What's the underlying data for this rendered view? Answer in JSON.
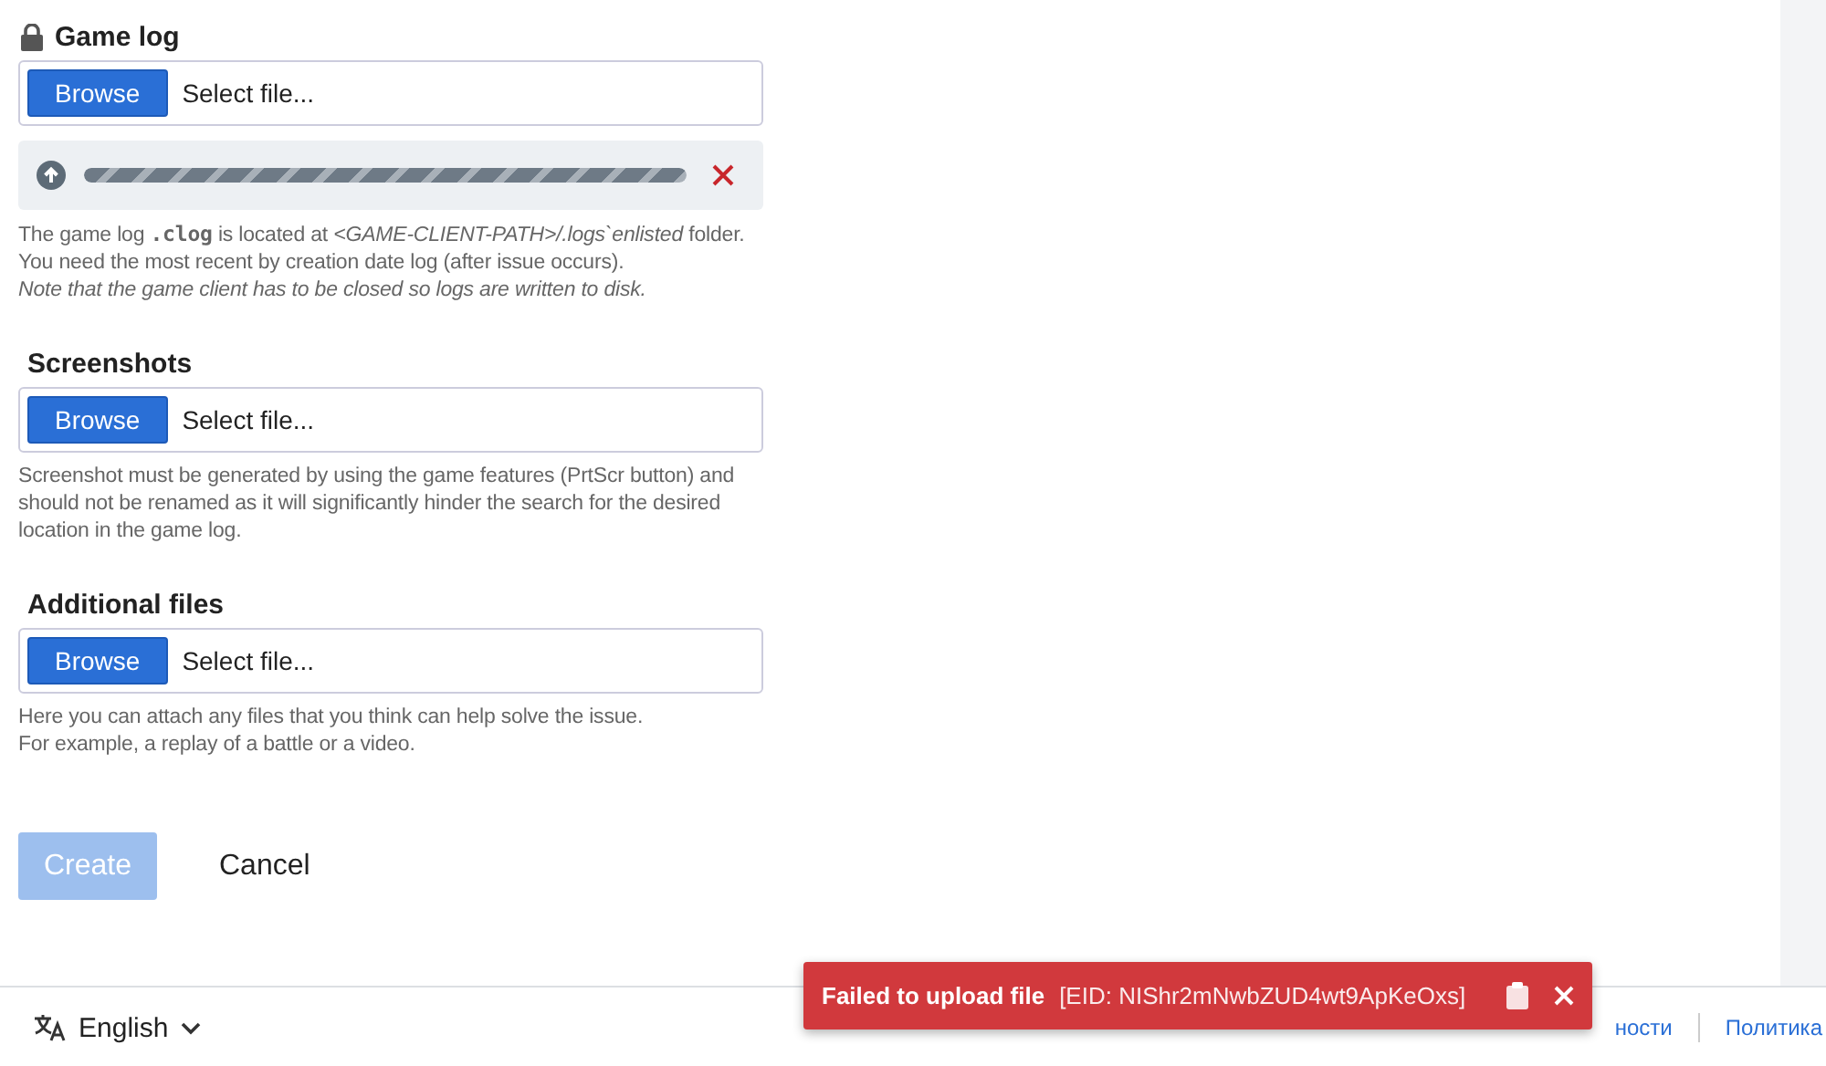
{
  "sections": [
    {
      "title": "Game log",
      "locked": true,
      "browse": "Browse",
      "placeholder": "Select file...",
      "upload": {
        "level": 1,
        "failed": true
      },
      "help": [
        "The game log **.clog** is located at *<GAME-CLIENT-PATH>/.logs`enlisted* folder.",
        "You need the most recent by creation date log (after issue occurs).",
        "*Note that the game client has to be closed so logs are written to disk.*"
      ]
    },
    {
      "title": "Screenshots",
      "locked": false,
      "browse": "Browse",
      "placeholder": "Select file...",
      "help": [
        "Screenshot must be generated by using the game features (PrtScr button) and should not be renamed as it will significantly hinder the search for the desired location in the game log."
      ]
    },
    {
      "title": "Additional files",
      "locked": false,
      "browse": "Browse",
      "placeholder": "Select file...",
      "help": [
        "Here you can attach any files that you think can help solve the issue.",
        "For example, a replay of a battle or a video."
      ]
    }
  ],
  "actions": {
    "create": {
      "label": "Create",
      "disabled": true
    },
    "cancel": "Cancel"
  },
  "footer": {
    "language": "English",
    "links": [
      "ности",
      "Политика"
    ]
  },
  "toast": {
    "message": "Failed to upload file",
    "eid": "[EID: NIShr2mNwbZUD4wt9ApKeOxs]"
  }
}
